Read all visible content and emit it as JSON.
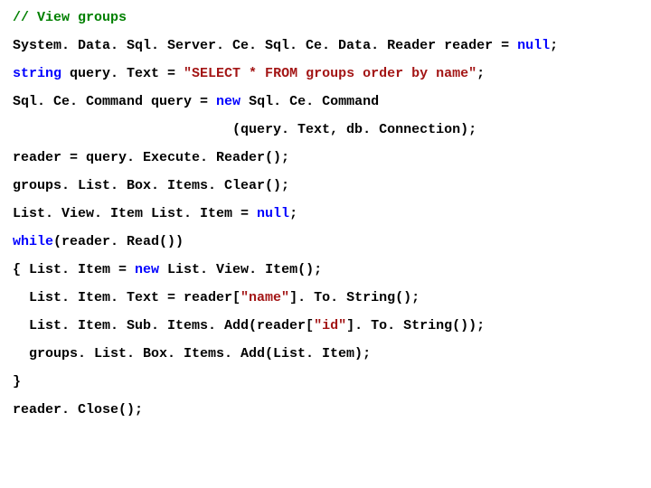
{
  "lines": {
    "l0": "// View groups",
    "l1a": "System. Data. Sql. Server. Ce. Sql. Ce. Data. Reader reader = ",
    "l1b": "null",
    "l1c": ";",
    "l2a": "string",
    "l2b": " query. Text = ",
    "l2c": "\"SELECT * FROM groups order by name\"",
    "l2d": ";",
    "l3a": "Sql. Ce. Command query = ",
    "l3b": "new",
    "l3c": " Sql. Ce. Command",
    "l4": "                           (query. Text, db. Connection);",
    "l5": "reader = query. Execute. Reader();",
    "l6": "groups. List. Box. Items. Clear();",
    "l7a": "List. View. Item List. Item = ",
    "l7b": "null",
    "l7c": ";",
    "l8a": "while",
    "l8b": "(reader. Read())",
    "l9a": "{ List. Item = ",
    "l9b": "new",
    "l9c": " List. View. Item();",
    "l10a": "  List. Item. Text = reader[",
    "l10b": "\"name\"",
    "l10c": "]. To. String();",
    "l11a": "  List. Item. Sub. Items. Add(reader[",
    "l11b": "\"id\"",
    "l11c": "]. To. String());",
    "l12": "  groups. List. Box. Items. Add(List. Item);",
    "l13": "}",
    "l14": "reader. Close();"
  }
}
